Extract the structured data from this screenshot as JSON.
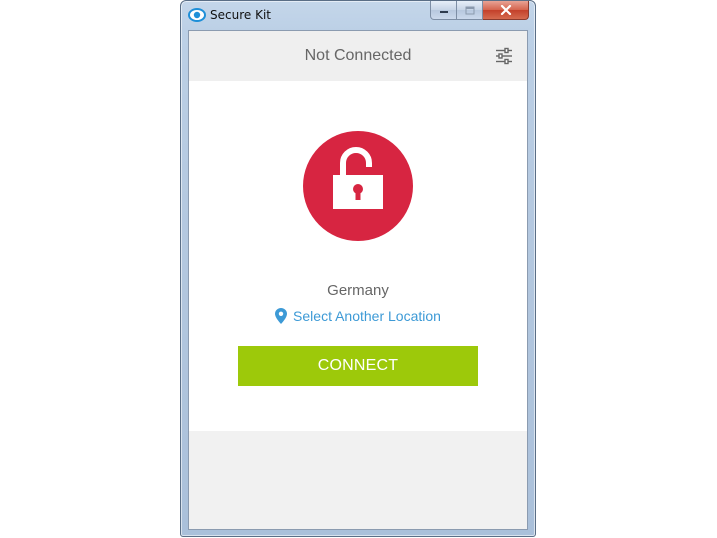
{
  "window": {
    "title": "Secure Kit",
    "controls": [
      "minimize",
      "maximize",
      "close"
    ]
  },
  "header": {
    "status": "Not Connected",
    "settings_icon": "sliders-icon"
  },
  "main": {
    "lock_icon": "unlocked-padlock-icon",
    "location": "Germany",
    "select_location_label": "Select Another Location",
    "location_pin_icon": "map-pin-icon",
    "connect_label": "CONNECT"
  },
  "colors": {
    "lock_circle": "#d72541",
    "connect_button": "#9dc90a",
    "link": "#3d9ad6",
    "status_text": "#666666"
  }
}
